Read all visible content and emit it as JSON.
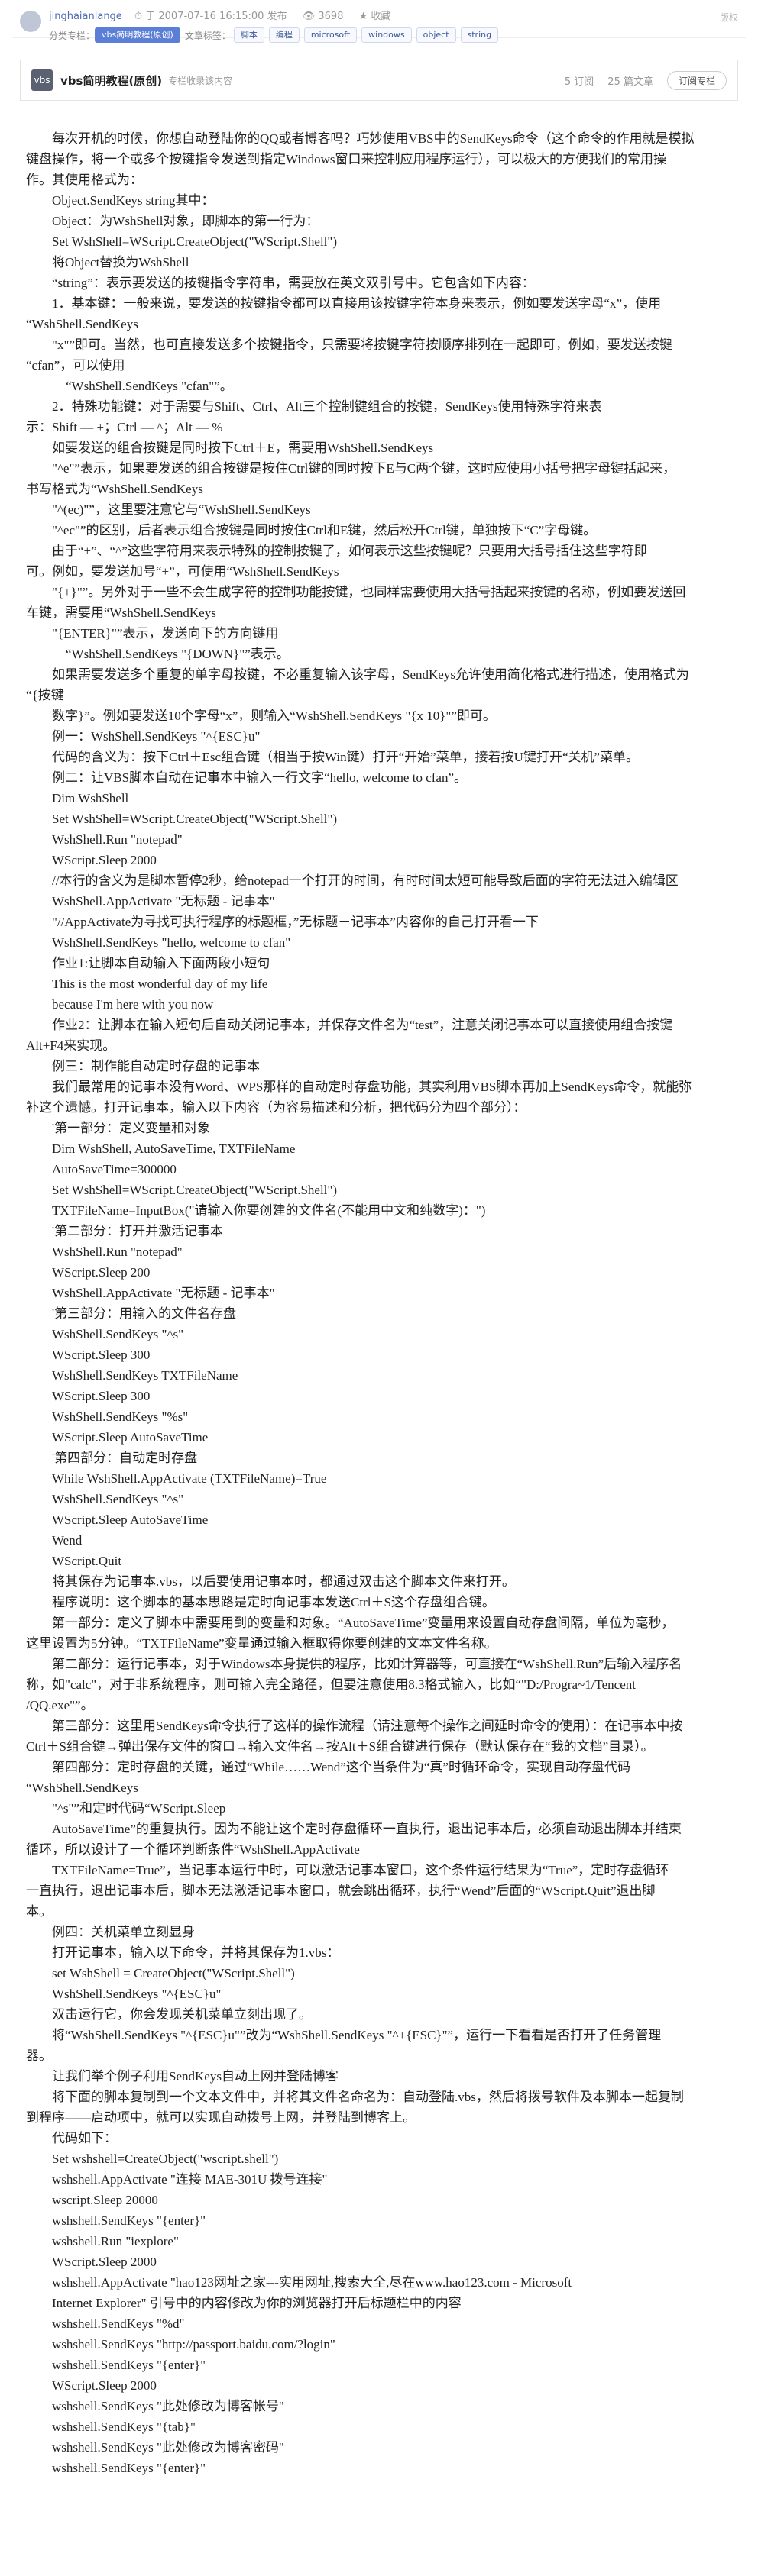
{
  "header": {
    "author": "jinghaianlange",
    "published": "于 2007-07-16 16:15:00 发布",
    "views": "3698",
    "fav": "收藏",
    "copyright": "版权",
    "col_label": "分类专栏：",
    "col_tag": "vbs简明教程(原创)",
    "art_tags_label": "文章标签：",
    "tags": [
      "脚本",
      "编程",
      "microsoft",
      "windows",
      "object",
      "string"
    ]
  },
  "column": {
    "icon": "vbs",
    "title": "vbs简明教程(原创)",
    "subtitle": "专栏收录该内容",
    "subs": "5 订阅",
    "articles": "25 篇文章",
    "subscribe": "订阅专栏"
  },
  "lines": [
    [
      "p",
      "每次开机的时候，你想自动登陆你的QQ或者博客吗？巧妙使用VBS中的SendKeys命令（这个命令的作用就是模拟"
    ],
    [
      "n",
      "键盘操作，将一个或多个按键指令发送到指定Windows窗口来控制应用程序运行），可以极大的方便我们的常用操"
    ],
    [
      "n",
      "作。其使用格式为："
    ],
    [
      "i1",
      "Object.SendKeys string其中："
    ],
    [
      "i1",
      "Object：为WshShell对象，即脚本的第一行为："
    ],
    [
      "i1",
      "Set WshShell=WScript.CreateObject(\"WScript.Shell\")"
    ],
    [
      "i1",
      "将Object替换为WshShell"
    ],
    [
      "i1",
      "“string”：表示要发送的按键指令字符串，需要放在英文双引号中。它包含如下内容："
    ],
    [
      "i1",
      "1．基本键：一般来说，要发送的按键指令都可以直接用该按键字符本身来表示，例如要发送字母“x”，使用"
    ],
    [
      "n",
      "“WshShell.SendKeys"
    ],
    [
      "i1",
      "\"x\"”即可。当然，也可直接发送多个按键指令，只需要将按键字符按顺序排列在一起即可，例如，要发送按键"
    ],
    [
      "n",
      "“cfan”，可以使用"
    ],
    [
      "i2",
      "“WshShell.SendKeys \"cfan\"”。"
    ],
    [
      "i1",
      "2．特殊功能键：对于需要与Shift、Ctrl、Alt三个控制键组合的按键，SendKeys使用特殊字符来表"
    ],
    [
      "n",
      "示：Shift — +；Ctrl — ^；Alt — %"
    ],
    [
      "i1",
      "如要发送的组合按键是同时按下Ctrl＋E，需要用WshShell.SendKeys"
    ],
    [
      "i1",
      "\"^e\"”表示，如果要发送的组合按键是按住Ctrl键的同时按下E与C两个键，这时应使用小括号把字母键括起来，"
    ],
    [
      "n",
      "书写格式为“WshShell.SendKeys"
    ],
    [
      "i1",
      "\"^(ec)\"”，这里要注意它与“WshShell.SendKeys"
    ],
    [
      "i1",
      "\"^ec\"”的区别，后者表示组合按键是同时按住Ctrl和E键，然后松开Ctrl键，单独按下“C”字母键。"
    ],
    [
      "i1",
      "由于“+”、“^”这些字符用来表示特殊的控制按键了，如何表示这些按键呢？只要用大括号括住这些字符即"
    ],
    [
      "n",
      "可。例如，要发送加号“+”，可使用“WshShell.SendKeys"
    ],
    [
      "i1",
      "\"{+}\"”。另外对于一些不会生成字符的控制功能按键，也同样需要使用大括号括起来按键的名称，例如要发送回"
    ],
    [
      "n",
      "车键，需要用“WshShell.SendKeys"
    ],
    [
      "i1",
      "\"{ENTER}\"”表示，发送向下的方向键用"
    ],
    [
      "i2",
      "“WshShell.SendKeys \"{DOWN}\"”表示。"
    ],
    [
      "i1",
      "如果需要发送多个重复的单字母按键，不必重复输入该字母，SendKeys允许使用简化格式进行描述，使用格式为"
    ],
    [
      "n",
      "“{按键"
    ],
    [
      "i1",
      "数字}”。例如要发送10个字母“x”，则输入“WshShell.SendKeys \"{x 10}\"”即可。"
    ],
    [
      "i1",
      "例一：WshShell.SendKeys \"^{ESC}u\""
    ],
    [
      "i1",
      "代码的含义为：按下Ctrl＋Esc组合键（相当于按Win键）打开“开始”菜单，接着按U键打开“关机”菜单。"
    ],
    [
      "i1",
      "例二：让VBS脚本自动在记事本中输入一行文字“hello, welcome to cfan”。"
    ],
    [
      "i1",
      "Dim WshShell"
    ],
    [
      "i1",
      "Set WshShell=WScript.CreateObject(\"WScript.Shell\")"
    ],
    [
      "i1",
      "WshShell.Run \"notepad\""
    ],
    [
      "i1",
      "WScript.Sleep 2000"
    ],
    [
      "i1",
      "//本行的含义为是脚本暂停2秒，给notepad一个打开的时间，有时时间太短可能导致后面的字符无法进入编辑区"
    ],
    [
      "i1",
      "WshShell.AppActivate \"无标题 - 记事本\""
    ],
    [
      "i1",
      "\"//AppActivate为寻找可执行程序的标题框，”无标题－记事本”内容你的自己打开看一下"
    ],
    [
      "i1",
      "WshShell.SendKeys \"hello, welcome to cfan\""
    ],
    [
      "i1",
      "作业1:让脚本自动输入下面两段小短句"
    ],
    [
      "i1",
      "This is the most wonderful day of my life"
    ],
    [
      "i1",
      "because I'm here with you now"
    ],
    [
      "i1",
      "作业2：让脚本在输入短句后自动关闭记事本，并保存文件名为“test”，注意关闭记事本可以直接使用组合按键"
    ],
    [
      "n",
      "Alt+F4来实现。"
    ],
    [
      "i1",
      "例三：制作能自动定时存盘的记事本"
    ],
    [
      "i1",
      "我们最常用的记事本没有Word、WPS那样的自动定时存盘功能，其实利用VBS脚本再加上SendKeys命令，就能弥"
    ],
    [
      "n",
      "补这个遗憾。打开记事本，输入以下内容（为容易描述和分析，把代码分为四个部分）："
    ],
    [
      "i1",
      "'第一部分：定义变量和对象"
    ],
    [
      "i1",
      "Dim WshShell, AutoSaveTime, TXTFileName"
    ],
    [
      "i1",
      "AutoSaveTime=300000"
    ],
    [
      "i1",
      "Set WshShell=WScript.CreateObject(\"WScript.Shell\")"
    ],
    [
      "i1",
      "TXTFileName=InputBox(\"请输入你要创建的文件名(不能用中文和纯数字)：\")"
    ],
    [
      "i1",
      "'第二部分：打开并激活记事本"
    ],
    [
      "i1",
      "WshShell.Run \"notepad\""
    ],
    [
      "i1",
      "WScript.Sleep 200"
    ],
    [
      "i1",
      "WshShell.AppActivate \"无标题 - 记事本\""
    ],
    [
      "i1",
      "'第三部分：用输入的文件名存盘"
    ],
    [
      "i1",
      "WshShell.SendKeys \"^s\""
    ],
    [
      "i1",
      "WScript.Sleep 300"
    ],
    [
      "i1",
      "WshShell.SendKeys TXTFileName"
    ],
    [
      "i1",
      "WScript.Sleep 300"
    ],
    [
      "i1",
      "WshShell.SendKeys \"%s\""
    ],
    [
      "i1",
      "WScript.Sleep AutoSaveTime"
    ],
    [
      "i1",
      "'第四部分：自动定时存盘"
    ],
    [
      "i1",
      "While WshShell.AppActivate (TXTFileName)=True"
    ],
    [
      "i1",
      "WshShell.SendKeys \"^s\""
    ],
    [
      "i1",
      "WScript.Sleep AutoSaveTime"
    ],
    [
      "i1",
      "Wend"
    ],
    [
      "i1",
      "WScript.Quit"
    ],
    [
      "i1",
      "将其保存为记事本.vbs，以后要使用记事本时，都通过双击这个脚本文件来打开。"
    ],
    [
      "i1",
      "程序说明：这个脚本的基本思路是定时向记事本发送Ctrl＋S这个存盘组合键。"
    ],
    [
      "i1",
      "第一部分：定义了脚本中需要用到的变量和对象。“AutoSaveTime”变量用来设置自动存盘间隔，单位为毫秒，"
    ],
    [
      "n",
      "这里设置为5分钟。“TXTFileName”变量通过输入框取得你要创建的文本文件名称。"
    ],
    [
      "i1",
      "第二部分：运行记事本，对于Windows本身提供的程序，比如计算器等，可直接在“WshShell.Run”后输入程序名"
    ],
    [
      "n",
      "称，如\"calc\"，对于非系统程序，则可输入完全路径，但要注意使用8.3格式输入，比如“\"D:/Progra~1/Tencent"
    ],
    [
      "n",
      "/QQ.exe\"”。"
    ],
    [
      "i1",
      "第三部分：这里用SendKeys命令执行了这样的操作流程（请注意每个操作之间延时命令的使用）：在记事本中按"
    ],
    [
      "n",
      "Ctrl＋S组合键→弹出保存文件的窗口→输入文件名→按Alt＋S组合键进行保存（默认保存在“我的文档”目录）。"
    ],
    [
      "i1",
      "第四部分：定时存盘的关键，通过“While……Wend”这个当条件为“真”时循环命令，实现自动存盘代码"
    ],
    [
      "n",
      "“WshShell.SendKeys"
    ],
    [
      "i1",
      "\"^s\"”和定时代码“WScript.Sleep"
    ],
    [
      "i1",
      "AutoSaveTime”的重复执行。因为不能让这个定时存盘循环一直执行，退出记事本后，必须自动退出脚本并结束"
    ],
    [
      "n",
      "循环，所以设计了一个循环判断条件“WshShell.AppActivate"
    ],
    [
      "i1",
      "TXTFileName=True”，当记事本运行中时，可以激活记事本窗口，这个条件运行结果为“True”，定时存盘循环"
    ],
    [
      "n",
      "一直执行，退出记事本后，脚本无法激活记事本窗口，就会跳出循环，执行“Wend”后面的“WScript.Quit”退出脚"
    ],
    [
      "n",
      "本。"
    ],
    [
      "i1",
      "例四：关机菜单立刻显身"
    ],
    [
      "i1",
      "打开记事本，输入以下命令，并将其保存为1.vbs："
    ],
    [
      "i1",
      "set WshShell = CreateObject(\"WScript.Shell\")"
    ],
    [
      "i1",
      "WshShell.SendKeys \"^{ESC}u\""
    ],
    [
      "i1",
      "双击运行它，你会发现关机菜单立刻出现了。"
    ],
    [
      "i1",
      "将“WshShell.SendKeys \"^{ESC}u\"”改为“WshShell.SendKeys \"^+{ESC}\"”，运行一下看看是否打开了任务管理"
    ],
    [
      "n",
      "器。"
    ],
    [
      "i1",
      "让我们举个例子利用SendKeys自动上网并登陆博客"
    ],
    [
      "i1",
      "将下面的脚本复制到一个文本文件中，并将其文件名命名为：自动登陆.vbs，然后将拨号软件及本脚本一起复制"
    ],
    [
      "n",
      "到程序——启动项中，就可以实现自动拨号上网，并登陆到博客上。"
    ],
    [
      "i1",
      "代码如下："
    ],
    [
      "i1",
      "Set wshshell=CreateObject(\"wscript.shell\")"
    ],
    [
      "i1",
      "wshshell.AppActivate \"连接 MAE-301U 拨号连接\""
    ],
    [
      "i1",
      "wscript.Sleep 20000"
    ],
    [
      "i1",
      "wshshell.SendKeys \"{enter}\""
    ],
    [
      "i1",
      "wshshell.Run \"iexplore\""
    ],
    [
      "i1",
      "WScript.Sleep 2000"
    ],
    [
      "i1",
      "wshshell.AppActivate \"hao123网址之家---实用网址,搜索大全,尽在www.hao123.com - Microsoft"
    ],
    [
      "i1",
      "Internet Explorer\" 引号中的内容修改为你的浏览器打开后标题栏中的内容"
    ],
    [
      "i1",
      "wshshell.SendKeys \"%d\""
    ],
    [
      "i1",
      "wshshell.SendKeys \"http://passport.baidu.com/?login\""
    ],
    [
      "i1",
      "wshshell.SendKeys \"{enter}\""
    ],
    [
      "i1",
      "WScript.Sleep 2000"
    ],
    [
      "i1",
      "wshshell.SendKeys \"此处修改为博客帐号\""
    ],
    [
      "i1",
      "wshshell.SendKeys \"{tab}\""
    ],
    [
      "i1",
      "wshshell.SendKeys \"此处修改为博客密码\""
    ],
    [
      "i1",
      "wshshell.SendKeys \"{enter}\""
    ]
  ]
}
